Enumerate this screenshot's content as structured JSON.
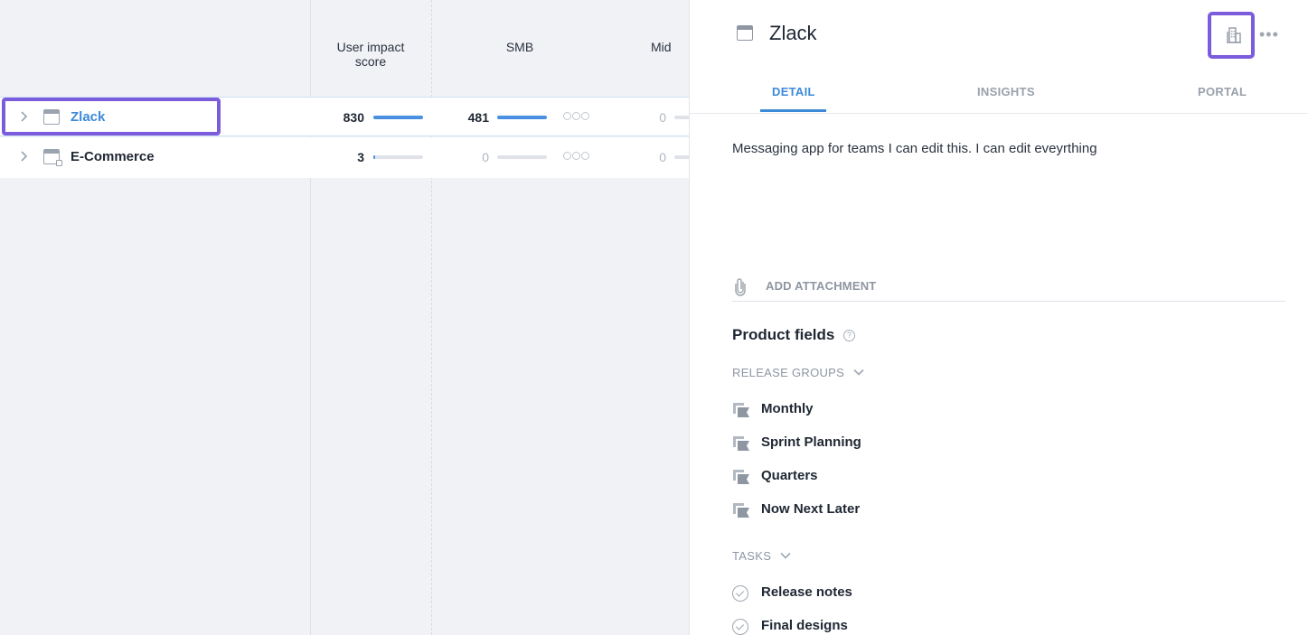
{
  "grid": {
    "columns": [
      {
        "label_line1": "User impact",
        "label_line2": "score"
      },
      {
        "label_line1": "SMB",
        "label_line2": ""
      },
      {
        "label_line1": "Mid",
        "label_line2": ""
      }
    ],
    "rows": [
      {
        "name": "Zlack",
        "impact_score": "830",
        "impact_fill": 1.0,
        "smb": "481",
        "smb_fill": 1.0,
        "mid": "0",
        "selected": true
      },
      {
        "name": "E-Commerce",
        "impact_score": "3",
        "impact_fill": 0.04,
        "smb": "0",
        "smb_fill": 0.0,
        "mid": "0",
        "selected": false
      }
    ]
  },
  "panel": {
    "title": "Zlack",
    "tabs": [
      {
        "label": "DETAIL",
        "active": true
      },
      {
        "label": "INSIGHTS",
        "active": false
      },
      {
        "label": "PORTAL",
        "active": false
      }
    ],
    "description": "Messaging app for teams I can edit this. I can edit eveyrthing",
    "attachment_label": "ADD ATTACHMENT",
    "product_fields_title": "Product fields",
    "release_groups_label": "RELEASE GROUPS",
    "release_groups": [
      "Monthly",
      "Sprint Planning",
      "Quarters",
      "Now Next Later"
    ],
    "tasks_label": "TASKS",
    "tasks": [
      "Release notes",
      "Final designs"
    ]
  },
  "colors": {
    "accent_blue": "#3d8ad9",
    "highlight_purple": "#7b5cdc",
    "bar_blue": "#4a90e2"
  },
  "icons": [
    "chevron-right-icon",
    "product-icon",
    "building-icon",
    "more-icon",
    "paperclip-icon",
    "help-icon",
    "chevron-down-icon",
    "release-group-icon",
    "task-check-icon"
  ]
}
